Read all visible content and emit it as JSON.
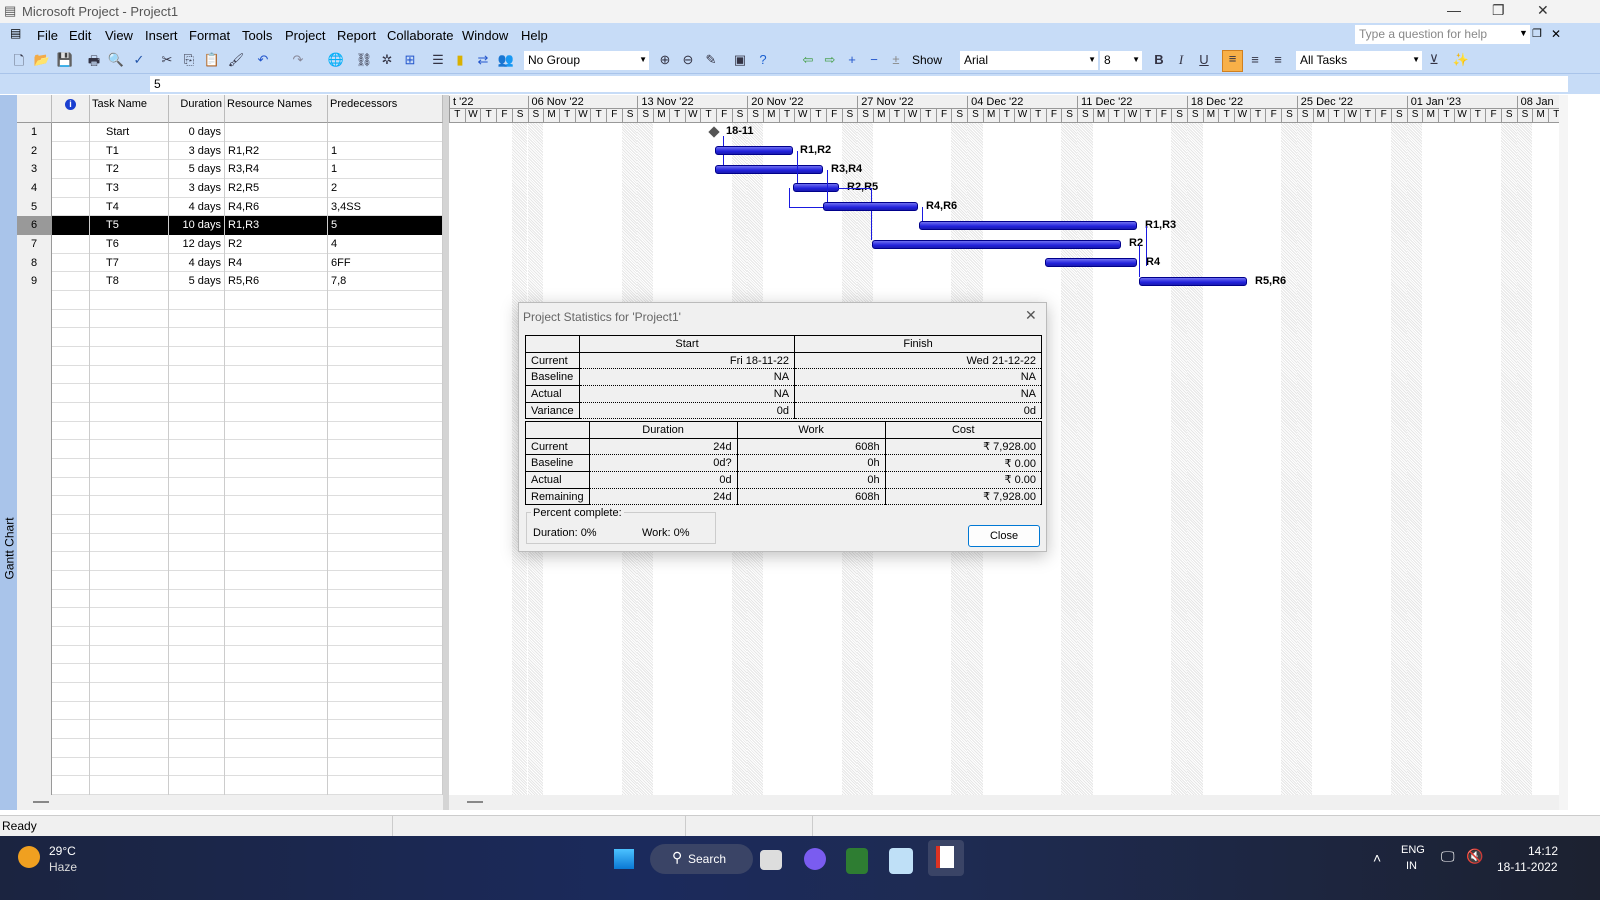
{
  "window": {
    "title": "Microsoft Project - Project1"
  },
  "menu": [
    "File",
    "Edit",
    "View",
    "Insert",
    "Format",
    "Tools",
    "Project",
    "Report",
    "Collaborate",
    "Window",
    "Help"
  ],
  "help_placeholder": "Type a question for help",
  "toolbar": {
    "group": "No Group",
    "show": "Show",
    "font": "Arial",
    "size": "8",
    "filter": "All Tasks",
    "bold": "B",
    "italic": "I",
    "underline": "U"
  },
  "entry_value": "5",
  "view_label": "Gantt Chart",
  "columns": [
    "Task Name",
    "Duration",
    "Resource Names",
    "Predecessors"
  ],
  "tasks": [
    {
      "id": "1",
      "name": "Start",
      "duration": "0 days",
      "resources": "",
      "pred": ""
    },
    {
      "id": "2",
      "name": "T1",
      "duration": "3 days",
      "resources": "R1,R2",
      "pred": "1"
    },
    {
      "id": "3",
      "name": "T2",
      "duration": "5 days",
      "resources": "R3,R4",
      "pred": "1"
    },
    {
      "id": "4",
      "name": "T3",
      "duration": "3 days",
      "resources": "R2,R5",
      "pred": "2"
    },
    {
      "id": "5",
      "name": "T4",
      "duration": "4 days",
      "resources": "R4,R6",
      "pred": "3,4SS"
    },
    {
      "id": "6",
      "name": "T5",
      "duration": "10 days",
      "resources": "R1,R3",
      "pred": "5"
    },
    {
      "id": "7",
      "name": "T6",
      "duration": "12 days",
      "resources": "R2",
      "pred": "4"
    },
    {
      "id": "8",
      "name": "T7",
      "duration": "4 days",
      "resources": "R4",
      "pred": "6FF"
    },
    {
      "id": "9",
      "name": "T8",
      "duration": "5 days",
      "resources": "R5,R6",
      "pred": "7,8"
    }
  ],
  "selected_row": "6",
  "timescale": {
    "weeks": [
      "t '22",
      "06 Nov '22",
      "13 Nov '22",
      "20 Nov '22",
      "27 Nov '22",
      "04 Dec '22",
      "11 Dec '22",
      "18 Dec '22",
      "25 Dec '22",
      "01 Jan '23",
      "08 Jan"
    ],
    "day_letters": [
      "S",
      "M",
      "T",
      "W",
      "T",
      "F",
      "S"
    ]
  },
  "gantt_labels": {
    "milestone": "18-11",
    "b1": "R1,R2",
    "b2": "R3,R4",
    "b3": "R2,R5",
    "b4": "R4,R6",
    "b5": "R1,R3",
    "b6": "R2",
    "b7": "R4",
    "b8": "R5,R6"
  },
  "dialog": {
    "title": "Project Statistics for 'Project1'",
    "dates_header": [
      "Start",
      "Finish"
    ],
    "dates": [
      [
        "Current",
        "Fri 18-11-22",
        "Wed 21-12-22"
      ],
      [
        "Baseline",
        "NA",
        "NA"
      ],
      [
        "Actual",
        "NA",
        "NA"
      ],
      [
        "Variance",
        "0d",
        "0d"
      ]
    ],
    "stats_header": [
      "Duration",
      "Work",
      "Cost"
    ],
    "stats": [
      [
        "Current",
        "24d",
        "608h",
        "₹ 7,928.00"
      ],
      [
        "Baseline",
        "0d?",
        "0h",
        "₹ 0.00"
      ],
      [
        "Actual",
        "0d",
        "0h",
        "₹ 0.00"
      ],
      [
        "Remaining",
        "24d",
        "608h",
        "₹ 7,928.00"
      ]
    ],
    "percent_label": "Percent complete:",
    "duration_pct": "Duration:  0%",
    "work_pct": "Work:  0%",
    "close": "Close"
  },
  "status": "Ready",
  "taskbar": {
    "temp": "29°C",
    "weather": "Haze",
    "search": "Search",
    "lang1": "ENG",
    "lang2": "IN",
    "time": "14:12",
    "date": "18-11-2022"
  }
}
